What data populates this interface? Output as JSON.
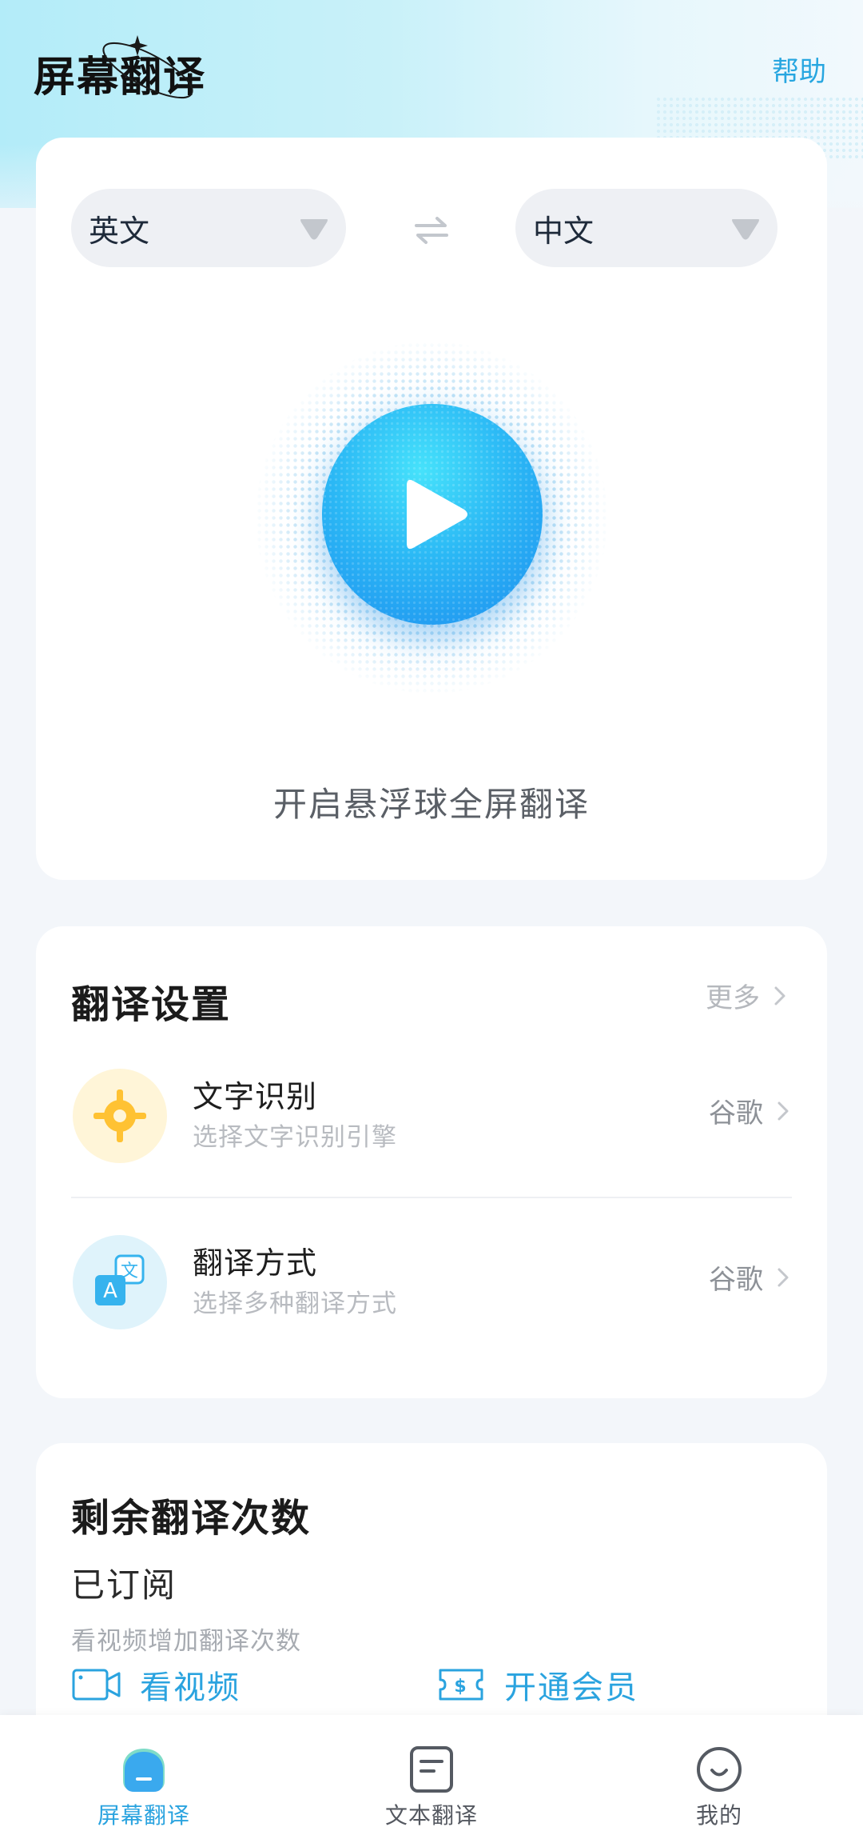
{
  "header": {
    "title": "屏幕翻译",
    "help": "帮助"
  },
  "languages": {
    "source": "英文",
    "target": "中文"
  },
  "main": {
    "caption": "开启悬浮球全屏翻译"
  },
  "settings": {
    "title": "翻译设置",
    "more": "更多",
    "items": [
      {
        "title": "文字识别",
        "subtitle": "选择文字识别引擎",
        "value": "谷歌",
        "icon": "ocr-target-icon"
      },
      {
        "title": "翻译方式",
        "subtitle": "选择多种翻译方式",
        "value": "谷歌",
        "icon": "translate-icon"
      }
    ]
  },
  "quota": {
    "title": "剩余翻译次数",
    "status": "已订阅",
    "hint": "看视频增加翻译次数",
    "watch_video": "看视频",
    "open_vip": "开通会员"
  },
  "nav": {
    "items": [
      {
        "label": "屏幕翻译",
        "active": true
      },
      {
        "label": "文本翻译",
        "active": false
      },
      {
        "label": "我的",
        "active": false
      }
    ]
  },
  "colors": {
    "accent": "#2aa3df",
    "play_button": "#2bb8f5",
    "ocr_icon": "#ffc233"
  }
}
